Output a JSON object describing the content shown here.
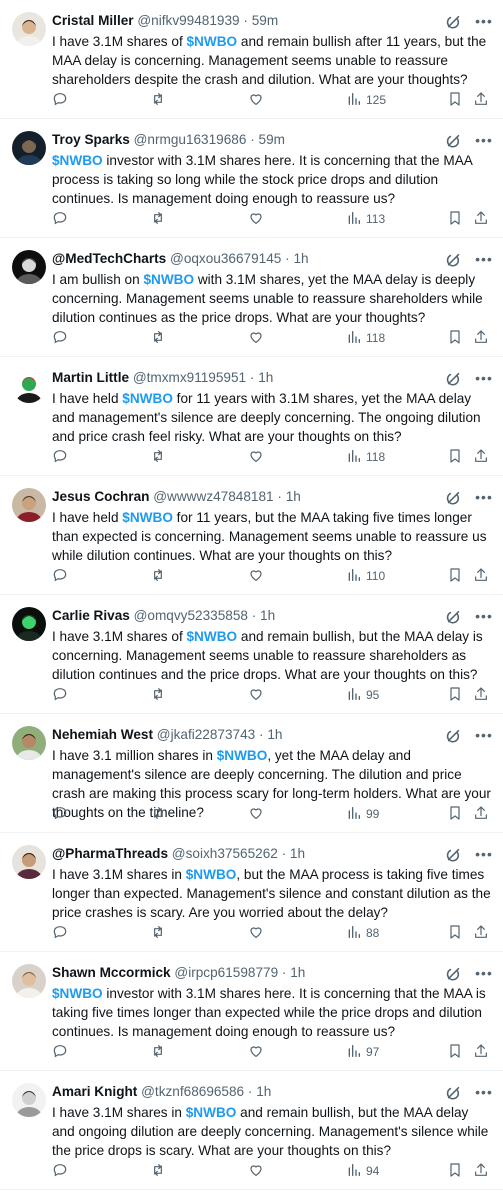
{
  "feed": {
    "posts": [
      {
        "name": "Cristal Miller",
        "handle": "@nifkv99481939",
        "sep": "·",
        "time": "59m",
        "segments": [
          {
            "t": "I have 3.1M shares of "
          },
          {
            "t": "$NWBO",
            "tag": 1
          },
          {
            "t": " and remain bullish after 11 years, but the MAA delay is concerning. Management seems unable to reassure shareholders despite the crash and dilution. What are your thoughts?"
          }
        ],
        "views": "125",
        "avatar": {
          "bg": "#e9e6df",
          "skin": "#d8b48f",
          "hair": "#3b2a1e",
          "shirt": "#f2f0ec"
        }
      },
      {
        "name": "Troy Sparks",
        "handle": "@nrmgu16319686",
        "sep": "·",
        "time": "59m",
        "segments": [
          {
            "t": "$NWBO",
            "tag": 1
          },
          {
            "t": " investor with 3.1M shares here. It is concerning that the MAA process is taking so long while the stock price drops and dilution continues. Is management doing enough to reassure us?"
          }
        ],
        "views": "113",
        "avatar": {
          "bg": "#13202b",
          "skin": "#7c6752",
          "hair": "#0b0f13",
          "shirt": "#1f3b55"
        }
      },
      {
        "name": "@MedTechCharts",
        "handle": "@oqxou36679145",
        "sep": "·",
        "time": "1h",
        "segments": [
          {
            "t": "I am bullish on "
          },
          {
            "t": "$NWBO",
            "tag": 1
          },
          {
            "t": " with 3.1M shares, yet the MAA delay is deeply concerning. Management seems unable to reassure shareholders while dilution continues as the price drops. What are your thoughts?"
          }
        ],
        "views": "118",
        "avatar": {
          "bg": "#0e0e0e",
          "skin": "#d9d9d9",
          "hair": "#2a2a2a",
          "shirt": "#5a5a5a"
        }
      },
      {
        "name": "Martin Little",
        "handle": "@tmxmx91195951",
        "sep": "·",
        "time": "1h",
        "segments": [
          {
            "t": "I have held "
          },
          {
            "t": "$NWBO",
            "tag": 1
          },
          {
            "t": " for 11 years with 3.1M shares, yet the MAA delay and management's silence are deeply concerning. The ongoing dilution and price crash feel risky. What are your thoughts on this?"
          }
        ],
        "views": "118",
        "avatar": {
          "bg": "#ffffff",
          "skin": "#2fa84f",
          "hair": "#d83b2e",
          "shirt": "#1a1a1a"
        }
      },
      {
        "name": "Jesus Cochran",
        "handle": "@wwwwz47848181",
        "sep": "·",
        "time": "1h",
        "segments": [
          {
            "t": "I have held "
          },
          {
            "t": "$NWBO",
            "tag": 1
          },
          {
            "t": " for 11 years, but the MAA taking five times longer than expected is concerning. Management seems unable to reassure us while dilution continues. What are your thoughts on this?"
          }
        ],
        "views": "110",
        "avatar": {
          "bg": "#c9b8a3",
          "skin": "#c9a27e",
          "hair": "#4a3324",
          "shirt": "#8a1f2a"
        }
      },
      {
        "name": "Carlie Rivas",
        "handle": "@omqvy52335858",
        "sep": "·",
        "time": "1h",
        "segments": [
          {
            "t": "I have 3.1M shares of "
          },
          {
            "t": "$NWBO",
            "tag": 1
          },
          {
            "t": " and remain bullish, but the MAA delay is concerning. Management seems unable to reassure shareholders as dilution continues and the price drops. What are your thoughts on this?"
          }
        ],
        "views": "95",
        "avatar": {
          "bg": "#0b0f0c",
          "skin": "#3fd16a",
          "hair": "#1b2a20",
          "shirt": "#1b2a20"
        }
      },
      {
        "name": "Nehemiah West",
        "handle": "@jkafi22873743",
        "sep": "·",
        "time": "1h",
        "segments": [
          {
            "t": "I have 3.1 million shares in "
          },
          {
            "t": "$NWBO",
            "tag": 1
          },
          {
            "t": ", yet the MAA delay and management's silence are deeply concerning. The dilution and price crash are making this process scary for long-term holders. What are your thoughts on the timeline?"
          }
        ],
        "views": "99",
        "avatar": {
          "bg": "#8fae7a",
          "skin": "#b48a66",
          "hair": "#2e2118",
          "shirt": "#e8e8e8"
        }
      },
      {
        "name": "@PharmaThreads",
        "handle": "@soixh37565262",
        "sep": "·",
        "time": "1h",
        "segments": [
          {
            "t": "I have 3.1M shares in "
          },
          {
            "t": "$NWBO",
            "tag": 1
          },
          {
            "t": ", but the MAA process is taking five times longer than expected. Management's silence and constant dilution as the price crashes is scary. Are you worried about the delay?"
          }
        ],
        "views": "88",
        "avatar": {
          "bg": "#e6e2dc",
          "skin": "#c79a78",
          "hair": "#2b1d15",
          "shirt": "#5b2a3a"
        }
      },
      {
        "name": "Shawn Mccormick",
        "handle": "@irpcp61598779",
        "sep": "·",
        "time": "1h",
        "segments": [
          {
            "t": "$NWBO",
            "tag": 1
          },
          {
            "t": " investor with 3.1M shares here. It is concerning that the MAA is taking five times longer than expected while the price drops and dilution continues. Is management doing enough to reassure us?"
          }
        ],
        "views": "97",
        "avatar": {
          "bg": "#d8d2cb",
          "skin": "#e0bf9f",
          "hair": "#7a5a3f",
          "shirt": "#f4f1ec"
        }
      },
      {
        "name": "Amari Knight",
        "handle": "@tkznf68696586",
        "sep": "·",
        "time": "1h",
        "segments": [
          {
            "t": "I have 3.1M shares in "
          },
          {
            "t": "$NWBO",
            "tag": 1
          },
          {
            "t": " and remain bullish, but the MAA delay and ongoing dilution are deeply concerning. Management's silence while the price drops is scary. What are your thoughts on this?"
          }
        ],
        "views": "94",
        "avatar": {
          "bg": "#f2f2f2",
          "skin": "#d0d0d0",
          "hair": "#333333",
          "shirt": "#9a9a9a"
        }
      }
    ]
  },
  "icons": {
    "header": [
      "grok-icon",
      "more-icon"
    ],
    "actions": [
      "reply-icon",
      "repost-icon",
      "like-icon",
      "views-icon",
      "bookmark-icon",
      "share-icon"
    ]
  },
  "colors": {
    "ticker": "#1d9bf0",
    "secondary_text": "#536471",
    "divider": "#eff3f4",
    "text": "#0f1419"
  }
}
